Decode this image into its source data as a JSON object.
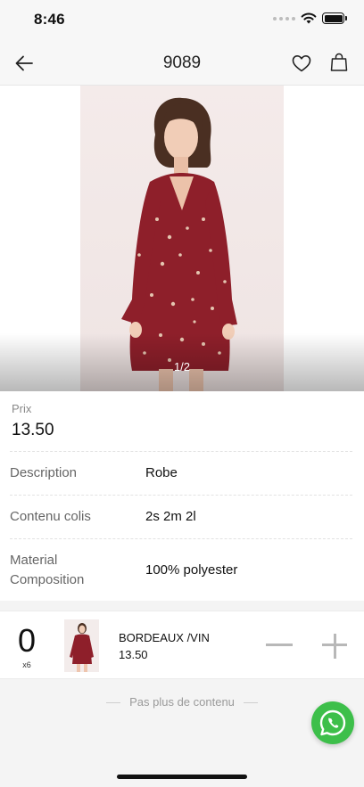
{
  "status_bar": {
    "time": "8:46"
  },
  "nav": {
    "title": "9089"
  },
  "gallery": {
    "counter": "1/2"
  },
  "price": {
    "label": "Prix",
    "value": "13.50"
  },
  "details": [
    {
      "label": "Description",
      "value": "Robe"
    },
    {
      "label": "Contenu colis",
      "value": "2s 2m 2l"
    },
    {
      "label": "Material Composition",
      "value": "100% polyester"
    }
  ],
  "cart": {
    "quantity": "0",
    "pack": "x6",
    "variant_name": "BORDEAUX /VIN",
    "variant_price": "13.50"
  },
  "footer": {
    "end_note": "Pas plus de contenu"
  },
  "colors": {
    "whatsapp": "#3dbf4a",
    "dress": "#8e1f2a",
    "controls": "#b8b8b8"
  },
  "icons": [
    "back-arrow-icon",
    "heart-icon",
    "shopping-bag-icon",
    "whatsapp-icon",
    "wifi-icon",
    "battery-icon"
  ]
}
